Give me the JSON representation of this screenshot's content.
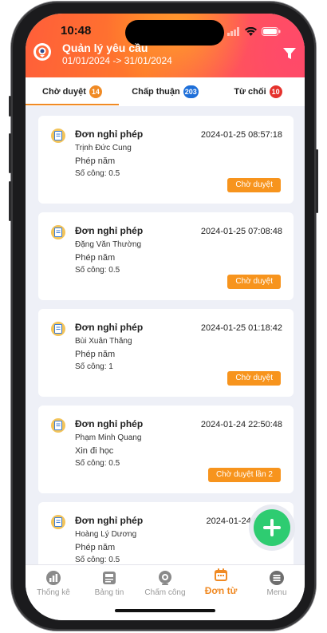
{
  "status_bar": {
    "time": "10:48"
  },
  "header": {
    "title": "Quản lý yêu cầu",
    "date_range": "01/01/2024 -> 31/01/2024",
    "logo_icon": "app-logo-icon",
    "filter_icon": "filter-icon"
  },
  "tabs": [
    {
      "label": "Chờ duyệt",
      "count": "14",
      "color": "#f08a24",
      "active": true
    },
    {
      "label": "Chấp thuận",
      "count": "203",
      "color": "#1e6fd9",
      "active": false
    },
    {
      "label": "Từ chối",
      "count": "10",
      "color": "#e5322d",
      "active": false
    }
  ],
  "requests": [
    {
      "title": "Đơn nghỉ phép",
      "time": "2024-01-25 08:57:18",
      "name": "Trịnh Đức Cung",
      "reason": "Phép năm",
      "days": "Số công: 0.5",
      "status": "Chờ duyệt"
    },
    {
      "title": "Đơn nghỉ phép",
      "time": "2024-01-25 07:08:48",
      "name": "Đặng Văn Thường",
      "reason": "Phép năm",
      "days": "Số công: 0.5",
      "status": "Chờ duyệt"
    },
    {
      "title": "Đơn nghỉ phép",
      "time": "2024-01-25 01:18:42",
      "name": "Bùi Xuân Thăng",
      "reason": "Phép năm",
      "days": "Số công: 1",
      "status": "Chờ duyệt"
    },
    {
      "title": "Đơn nghỉ phép",
      "time": "2024-01-24 22:50:48",
      "name": "Phạm Minh Quang",
      "reason": "Xin đi học",
      "days": "Số công: 0.5",
      "status": "Chờ duyệt lần 2"
    },
    {
      "title": "Đơn nghỉ phép",
      "time": "2024-01-24 0",
      "name": "Hoàng Lý Dương",
      "reason": "Phép năm",
      "days": "Số công: 0.5",
      "status": ""
    }
  ],
  "fab": {
    "icon": "plus-icon",
    "color": "#2ecc71"
  },
  "bottom_nav": [
    {
      "label": "Thống kê",
      "icon": "chart-icon",
      "active": false
    },
    {
      "label": "Bảng tin",
      "icon": "news-icon",
      "active": false
    },
    {
      "label": "Chấm công",
      "icon": "camera-icon",
      "active": false
    },
    {
      "label": "Đơn từ",
      "icon": "calendar-icon",
      "active": true
    },
    {
      "label": "Menu",
      "icon": "menu-icon",
      "active": false
    }
  ],
  "accent_color": "#f08a24"
}
